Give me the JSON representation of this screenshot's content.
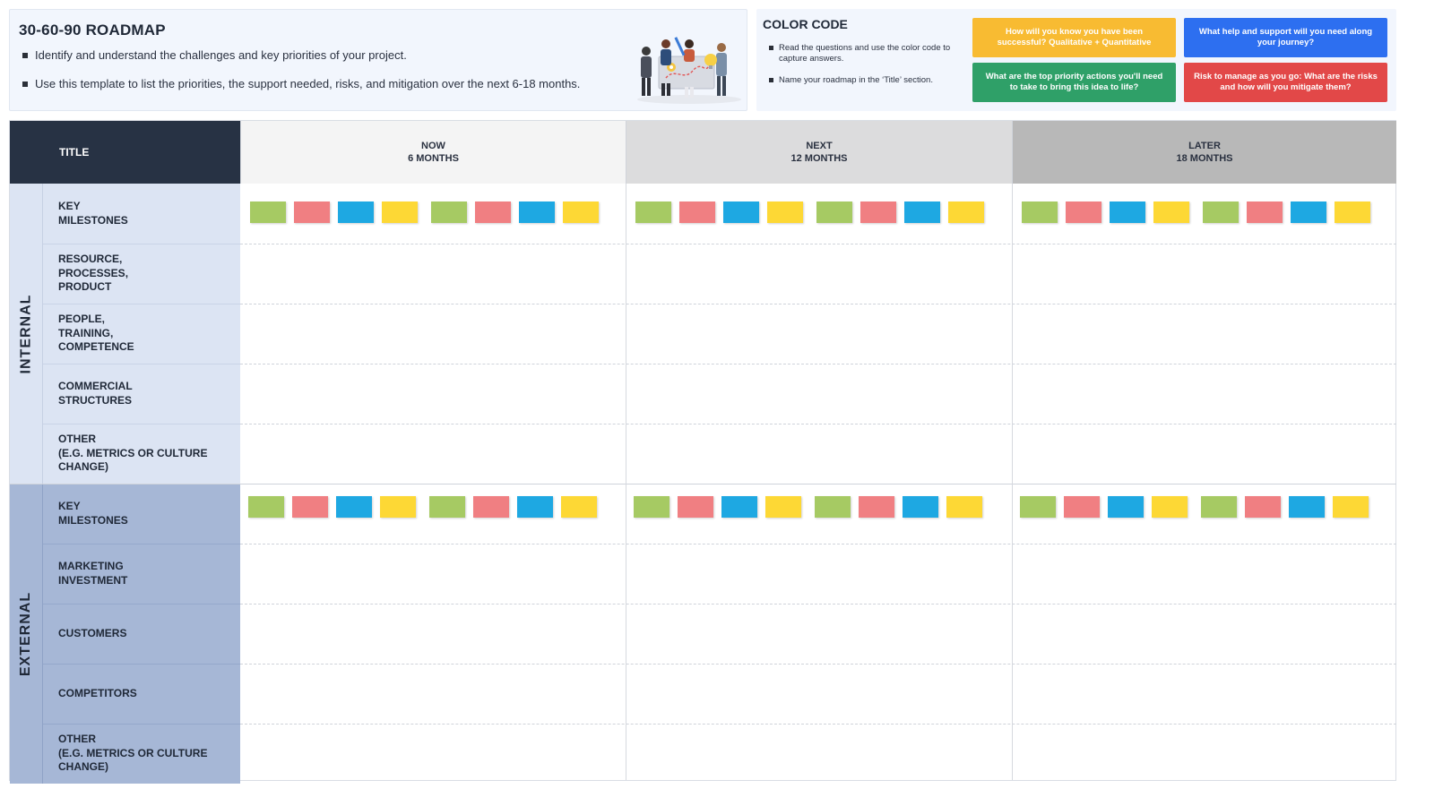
{
  "info": {
    "title": "30-60-90 ROADMAP",
    "bullets": [
      "Identify and understand the challenges and key priorities of your project.",
      "Use this template to list the priorities, the support needed, risks, and mitigation over the next 6-18 months."
    ],
    "illustration_icon": "team-collaboration-illustration"
  },
  "color_code": {
    "title": "COLOR CODE",
    "bullets": [
      "Read the questions and use the color code to capture answers.",
      "Name your roadmap in the ‘Title’ section."
    ],
    "boxes": [
      {
        "text": "How will you know you have been successful? Qualitative + Quantitative",
        "color": "#f8bb32"
      },
      {
        "text": "What help and support will you need along your journey?",
        "color": "#2d6ff0"
      },
      {
        "text": "What are the top priority actions you'll need to take to bring this idea to life?",
        "color": "#2fa068"
      },
      {
        "text": "Risk to manage as you go: What are the risks and how will you mitigate them?",
        "color": "#e24848"
      }
    ]
  },
  "grid": {
    "title_label": "TITLE",
    "columns": [
      {
        "line1": "NOW",
        "line2": "6 MONTHS",
        "bg": "#f4f4f4"
      },
      {
        "line1": "NEXT",
        "line2": "12 MONTHS",
        "bg": "#dcdcdd"
      },
      {
        "line1": "LATER",
        "line2": "18 MONTHS",
        "bg": "#b8b8b8"
      }
    ],
    "sections": [
      {
        "name": "INTERNAL",
        "color": "#dce4f3",
        "rows": [
          "KEY\nMILESTONES",
          "RESOURCE,\nPROCESSES,\nPRODUCT",
          "PEOPLE,\nTRAINING,\nCOMPETENCE",
          "COMMERCIAL\nSTRUCTURES",
          "OTHER\n(E.G. METRICS OR CULTURE\nCHANGE)"
        ]
      },
      {
        "name": "EXTERNAL",
        "color": "#a6b7d6",
        "rows": [
          "KEY\nMILESTONES",
          "MARKETING\nINVESTMENT",
          "CUSTOMERS",
          "COMPETITORS",
          "OTHER\n(E.G. METRICS OR CULTURE\nCHANGE)"
        ]
      }
    ],
    "sticky_colors": [
      "#a6ca63",
      "#f07f82",
      "#1ea8e2",
      "#fdd835",
      "#a6ca63",
      "#f07f82",
      "#1ea8e2",
      "#fdd835"
    ]
  }
}
